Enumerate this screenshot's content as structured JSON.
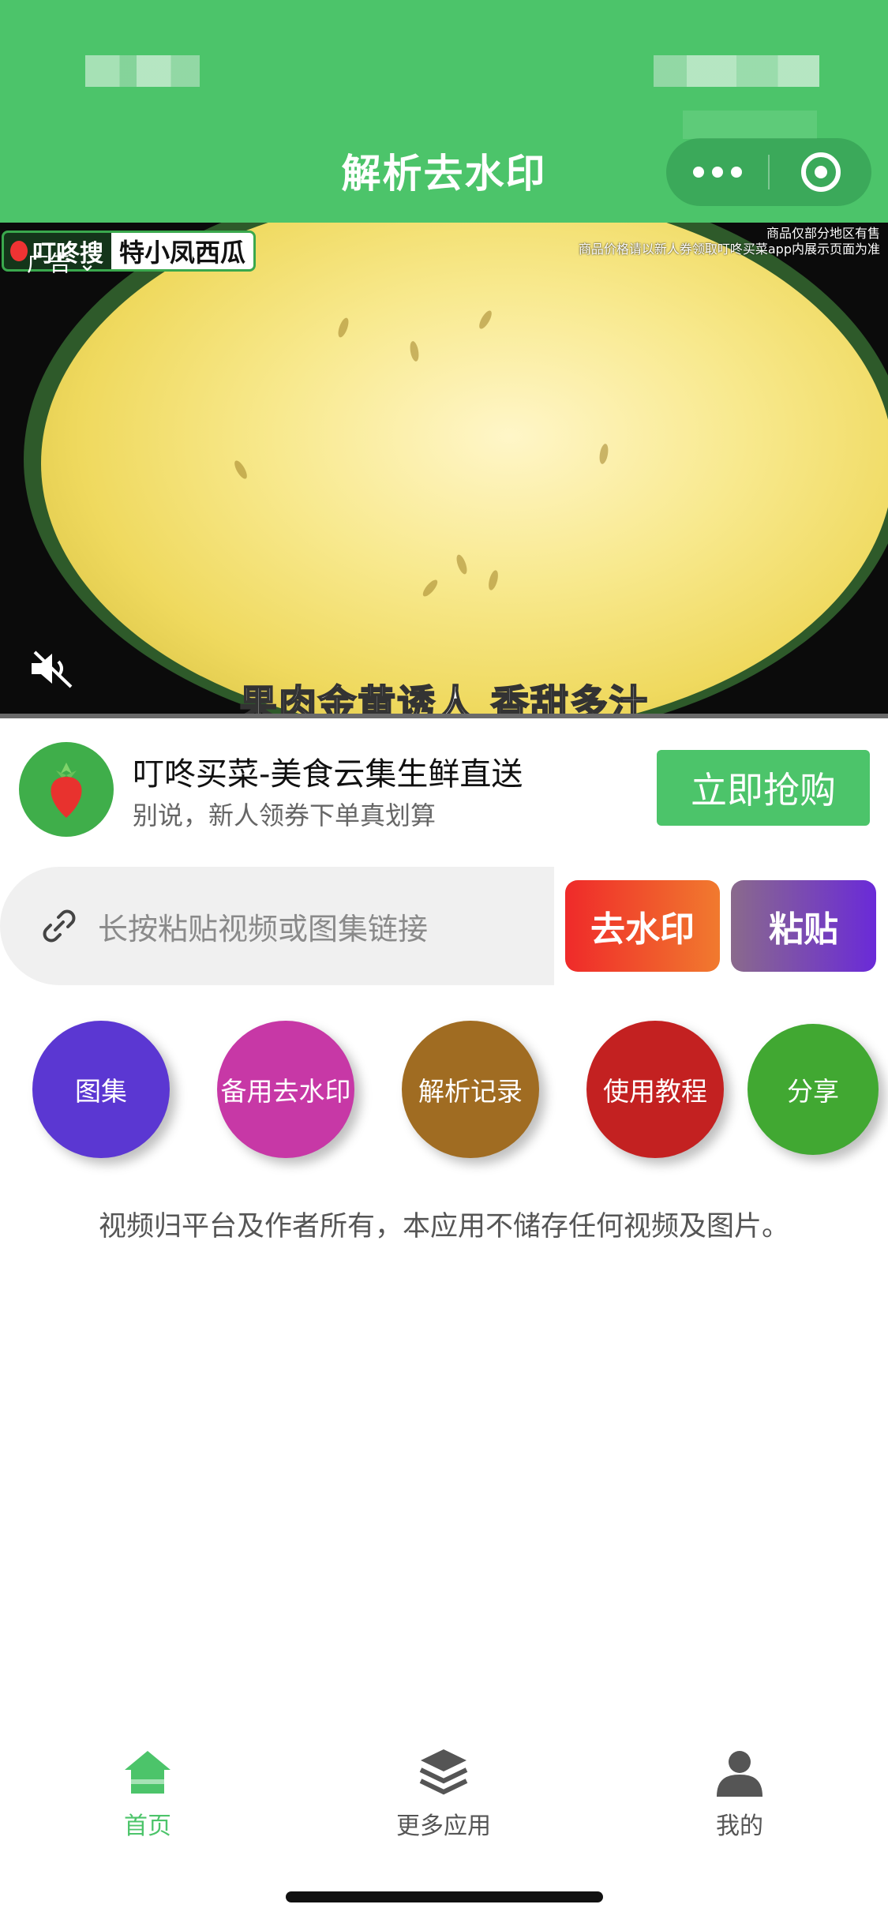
{
  "header": {
    "title": "解析去水印",
    "more_label": "•••",
    "color": "#4cc46a"
  },
  "video_ad": {
    "ad_label": "广告",
    "brand_badge": "叮咚搜",
    "brand_product": "特小凤西瓜",
    "note": "商品仅部分地区有售\n商品价格请以新人券领取叮咚买菜app内展示页面为准",
    "caption": "果肉金黄诱人 香甜多汁"
  },
  "ad_row": {
    "title": "叮咚买菜-美食云集生鲜直送",
    "subtitle": "别说，新人领券下单真划算",
    "cta": "立即抢购"
  },
  "search": {
    "placeholder": "长按粘贴视频或图集链接",
    "remove_label": "去水印",
    "paste_label": "粘贴"
  },
  "actions": [
    {
      "label": "图集",
      "color": "#5b37d2"
    },
    {
      "label": "备用去水印",
      "color": "#c738a6"
    },
    {
      "label": "解析记录",
      "color": "#a06c22"
    },
    {
      "label": "使用教程",
      "color": "#c32121"
    },
    {
      "label": "分享",
      "color": "#41a832"
    }
  ],
  "disclaimer": "视频归平台及作者所有，本应用不储存任何视频及图片。",
  "tabbar": {
    "items": [
      {
        "label": "首页",
        "icon": "home-icon",
        "active": true
      },
      {
        "label": "更多应用",
        "icon": "layers-icon",
        "active": false
      },
      {
        "label": "我的",
        "icon": "user-icon",
        "active": false
      }
    ]
  }
}
